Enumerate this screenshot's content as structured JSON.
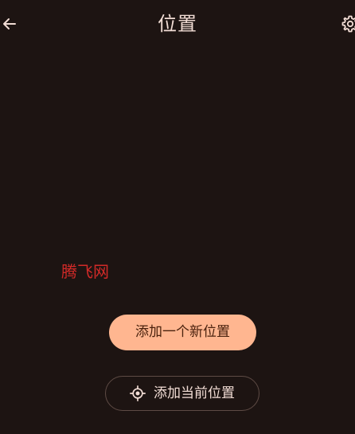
{
  "header": {
    "title": "位置",
    "back_icon": "arrow-left-icon",
    "settings_icon": "gear-icon"
  },
  "watermark": {
    "text": "腾飞网",
    "color": "#d22a28"
  },
  "actions": {
    "add_new_location": "添加一个新位置",
    "add_current_location": "添加当前位置",
    "current_location_icon": "my-location-icon"
  },
  "colors": {
    "background": "#1d1412",
    "primary_button": "#ffb690",
    "text": "#f2ddd5"
  }
}
